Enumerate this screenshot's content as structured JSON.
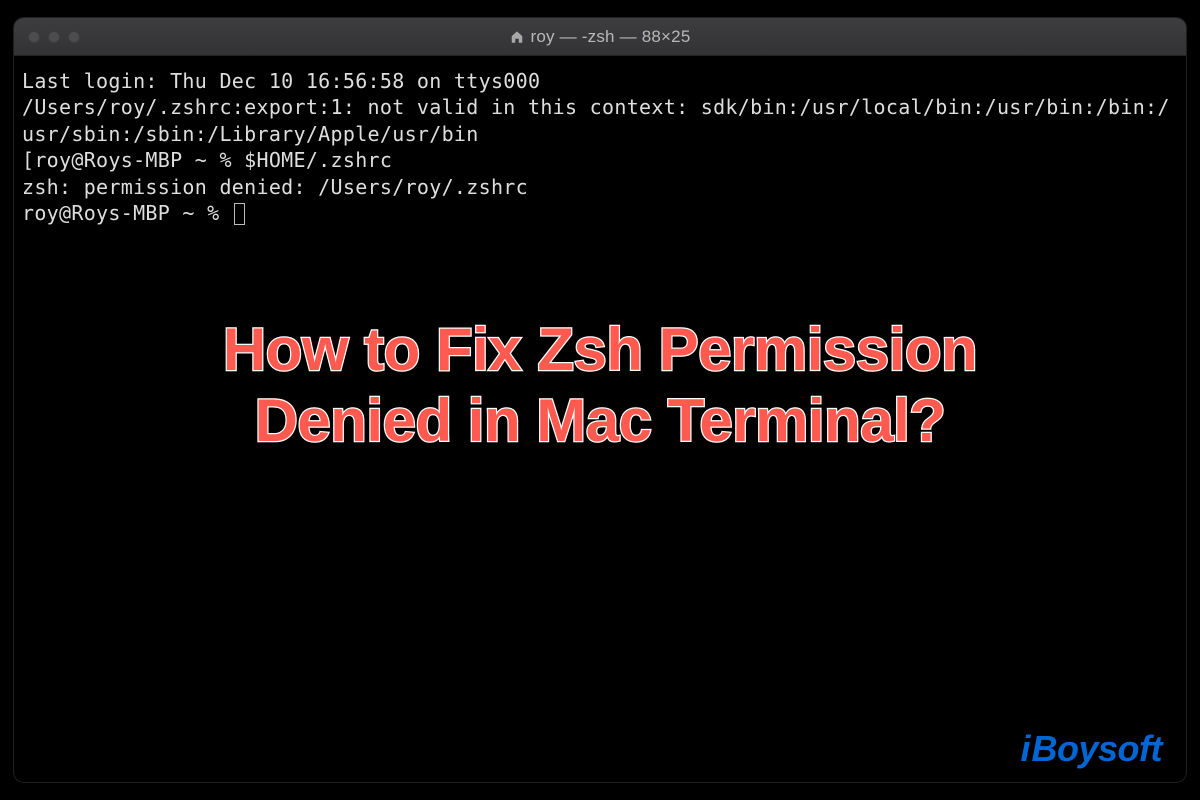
{
  "window": {
    "title": "roy — -zsh — 88×25"
  },
  "terminal": {
    "lines": [
      "Last login: Thu Dec 10 16:56:58 on ttys000",
      "/Users/roy/.zshrc:export:1: not valid in this context: sdk/bin:/usr/local/bin:/usr/bin:/bin:/usr/sbin:/sbin:/Library/Apple/usr/bin",
      "[roy@Roys-MBP ~ % $HOME/.zshrc",
      "zsh: permission denied: /Users/roy/.zshrc",
      "roy@Roys-MBP ~ % "
    ]
  },
  "overlay": {
    "headline_line1": "How to Fix Zsh Permission",
    "headline_line2": "Denied in Mac Terminal?"
  },
  "brand": {
    "prefix": "i",
    "rest": "Boysoft"
  }
}
